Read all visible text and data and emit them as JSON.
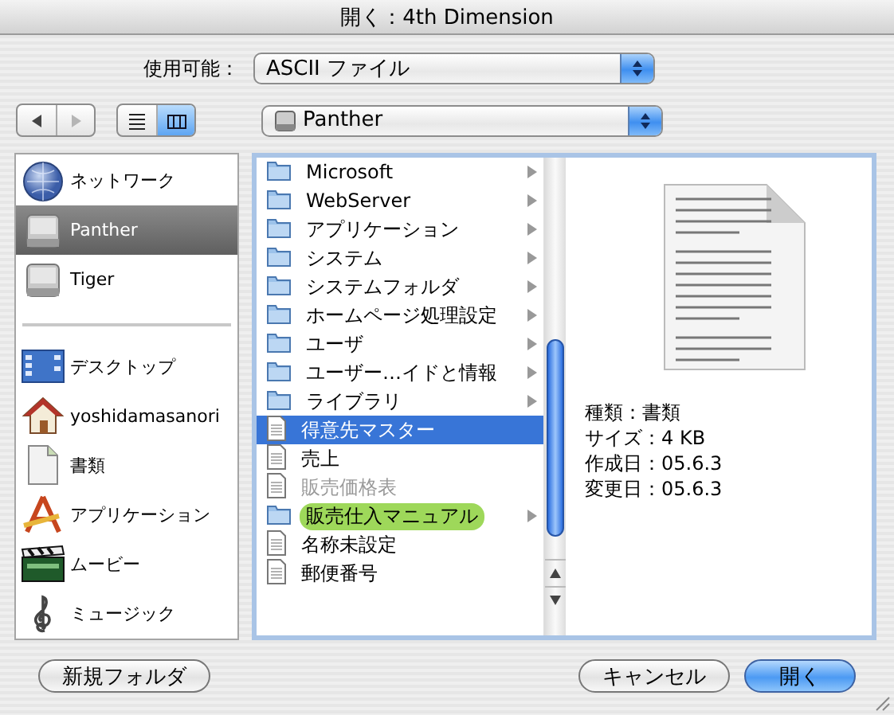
{
  "window": {
    "title": "開く：4th Dimension"
  },
  "format": {
    "label": "使用可能：",
    "value": "ASCII ファイル"
  },
  "nav": [
    {
      "kind": "back",
      "disabled": false
    },
    {
      "kind": "forward",
      "disabled": true
    }
  ],
  "view_buttons": [
    {
      "kind": "list",
      "selected": false
    },
    {
      "kind": "columns",
      "selected": true
    }
  ],
  "location": {
    "value": "Panther"
  },
  "sidebar": {
    "groups": [
      [
        {
          "label": "ネットワーク",
          "kind": "network",
          "selected": false
        },
        {
          "label": "Panther",
          "kind": "disk",
          "selected": true
        },
        {
          "label": "Tiger",
          "kind": "disk",
          "selected": false
        }
      ],
      [
        {
          "label": "デスクトップ",
          "kind": "desktop",
          "selected": false
        },
        {
          "label": "yoshidamasanori",
          "kind": "home",
          "selected": false
        },
        {
          "label": "書類",
          "kind": "documents",
          "selected": false
        },
        {
          "label": "アプリケーション",
          "kind": "applications",
          "selected": false
        },
        {
          "label": "ムービー",
          "kind": "movies",
          "selected": false
        },
        {
          "label": "ミュージック",
          "kind": "music",
          "selected": false
        }
      ]
    ]
  },
  "browser": {
    "column_1": [
      {
        "name": "Microsoft",
        "kind": "folder",
        "selected": false,
        "disabled": false
      },
      {
        "name": "WebServer",
        "kind": "folder",
        "selected": false,
        "disabled": false
      },
      {
        "name": "アプリケーション",
        "kind": "folder",
        "selected": false,
        "disabled": false
      },
      {
        "name": "システム",
        "kind": "folder",
        "selected": false,
        "disabled": false
      },
      {
        "name": "システムフォルダ",
        "kind": "folder",
        "selected": false,
        "disabled": false
      },
      {
        "name": "ホームページ処理設定",
        "kind": "folder",
        "selected": false,
        "disabled": false
      },
      {
        "name": "ユーザ",
        "kind": "folder",
        "selected": false,
        "disabled": false
      },
      {
        "name": "ユーザー…イドと情報",
        "kind": "folder",
        "selected": false,
        "disabled": false
      },
      {
        "name": "ライブラリ",
        "kind": "folder",
        "selected": false,
        "disabled": false
      },
      {
        "name": "得意先マスター",
        "kind": "document",
        "selected": true,
        "disabled": false
      },
      {
        "name": "売上",
        "kind": "document",
        "selected": false,
        "disabled": false
      },
      {
        "name": "販売価格表",
        "kind": "document",
        "selected": false,
        "disabled": true
      },
      {
        "name": "販売仕入マニュアル",
        "kind": "folder",
        "selected": false,
        "disabled": false,
        "color": "#9ed85a"
      },
      {
        "name": "名称未設定",
        "kind": "document",
        "selected": false,
        "disabled": false
      },
      {
        "name": "郵便番号",
        "kind": "document",
        "selected": false,
        "disabled": false
      }
    ],
    "preview": {
      "info": [
        "種類：書類",
        "サイズ：4 KB",
        "作成日：05.6.3",
        "変更日：05.6.3"
      ]
    }
  },
  "buttons_left": [
    {
      "label": "新規フォルダ",
      "default": false
    }
  ],
  "buttons_right": [
    {
      "label": "キャンセル",
      "default": false
    },
    {
      "label": "開く",
      "default": true
    }
  ]
}
